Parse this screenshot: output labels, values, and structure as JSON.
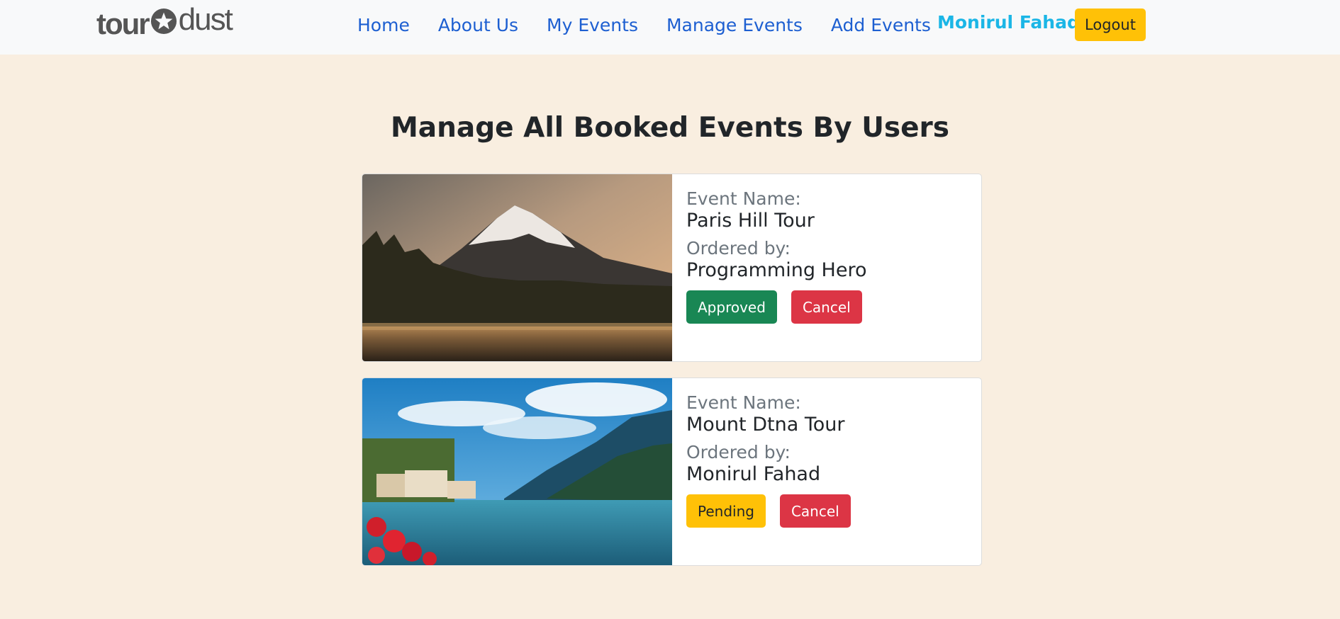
{
  "navbar": {
    "logo": {
      "word1": "tour",
      "word2": "dust"
    },
    "links": [
      "Home",
      "About Us",
      "My Events",
      "Manage Events",
      "Add Events"
    ],
    "user_name": "Monirul Fahad",
    "logout_label": "Logout"
  },
  "main": {
    "title": "Manage All Booked Events By Users",
    "bookings": [
      {
        "event_label": "Event Name:",
        "event_name": "Paris Hill Tour",
        "ordered_label": "Ordered by:",
        "ordered_by": "Programming Hero",
        "status_label": "Approved",
        "cancel_label": "Cancel",
        "image": "mountain-lake-photo"
      },
      {
        "event_label": "Event Name:",
        "event_name": "Mount Dtna Tour",
        "ordered_label": "Ordered by:",
        "ordered_by": "Monirul Fahad",
        "status_label": "Pending",
        "cancel_label": "Cancel",
        "image": "lakeside-village-photo"
      }
    ]
  },
  "colors": {
    "background": "#f9eee0",
    "nav_link": "#1d5fd1",
    "user_name": "#1bb6e6",
    "approved": "#198754",
    "pending": "#ffc107",
    "cancel": "#dc3545"
  }
}
